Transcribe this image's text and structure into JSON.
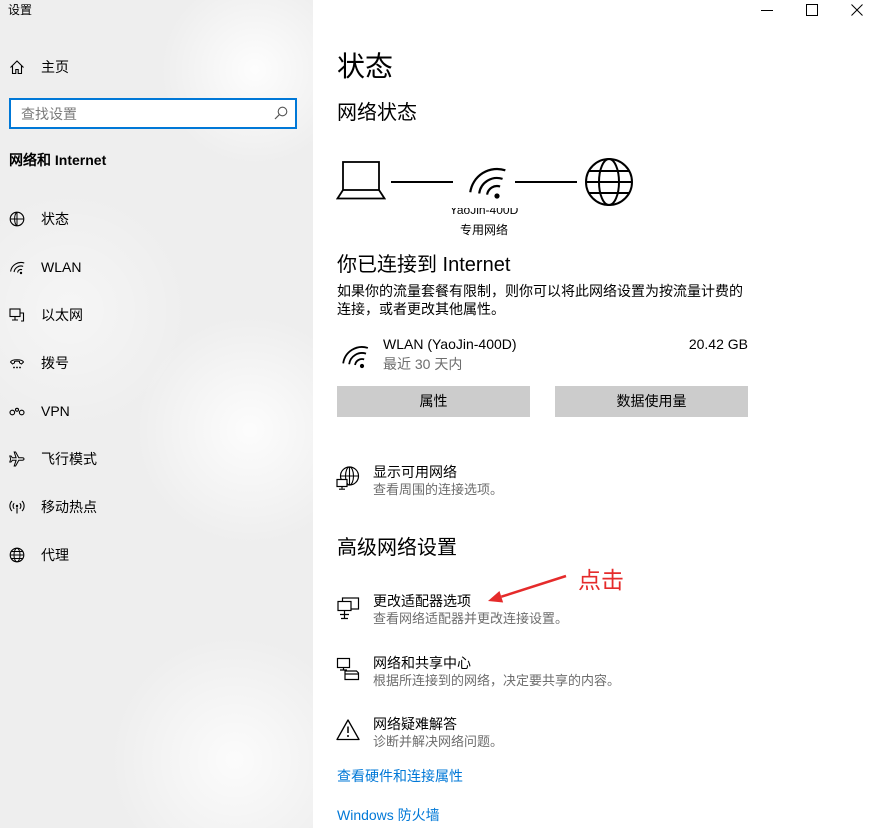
{
  "window": {
    "title": "设置",
    "controls": [
      "minimize-icon",
      "maximize-icon",
      "close-icon"
    ]
  },
  "colors": {
    "accent": "#0078d7",
    "annotation": "#e52b2b",
    "button_background": "#cccccc",
    "secondary_text": "#6d6d6d",
    "sidebar_background": "#eeeeee"
  },
  "sidebar": {
    "home": {
      "label": "主页",
      "icon": "home-icon"
    },
    "search": {
      "placeholder": "查找设置",
      "icon": "search-icon"
    },
    "section_title": "网络和 Internet",
    "items": [
      {
        "label": "状态",
        "icon": "status-globe-icon"
      },
      {
        "label": "WLAN",
        "icon": "wifi-icon"
      },
      {
        "label": "以太网",
        "icon": "ethernet-icon"
      },
      {
        "label": "拨号",
        "icon": "dialup-icon"
      },
      {
        "label": "VPN",
        "icon": "vpn-icon"
      },
      {
        "label": "飞行模式",
        "icon": "airplane-icon"
      },
      {
        "label": "移动热点",
        "icon": "hotspot-icon"
      },
      {
        "label": "代理",
        "icon": "proxy-globe-icon"
      }
    ]
  },
  "main": {
    "title": "状态",
    "network_status": {
      "heading": "网络状态",
      "diagram_icons": [
        "laptop-icon",
        "wifi-icon",
        "internet-globe-icon"
      ],
      "network_name": "YaoJin-400D",
      "network_type": "专用网络"
    },
    "connected": {
      "heading": "你已连接到 Internet",
      "description_lines": [
        "如果你的流量套餐有限制，则你可以将此网络设置为按流量计费的",
        "连接，或者更改其他属性。"
      ]
    },
    "connection": {
      "icon": "wifi-icon",
      "name": "WLAN (YaoJin-400D)",
      "period": "最近 30 天内",
      "data_used": "20.42 GB"
    },
    "buttons": {
      "properties": "属性",
      "data_usage": "数据使用量"
    },
    "show_networks": {
      "icon": "show-networks-icon",
      "title": "显示可用网络",
      "description": "查看周围的连接选项。"
    },
    "advanced": {
      "heading": "高级网络设置",
      "items": [
        {
          "icon": "adapter-icon",
          "title": "更改适配器选项",
          "description": "查看网络适配器并更改连接设置。"
        },
        {
          "icon": "sharing-center-icon",
          "title": "网络和共享中心",
          "description": "根据所连接到的网络，决定要共享的内容。"
        },
        {
          "icon": "warning-icon",
          "title": "网络疑难解答",
          "description": "诊断并解决网络问题。"
        }
      ]
    },
    "links": [
      {
        "label": "查看硬件和连接属性"
      },
      {
        "label": "Windows 防火墙"
      }
    ]
  },
  "annotation": {
    "label": "点击",
    "arrow_icon": "red-arrow-icon"
  }
}
